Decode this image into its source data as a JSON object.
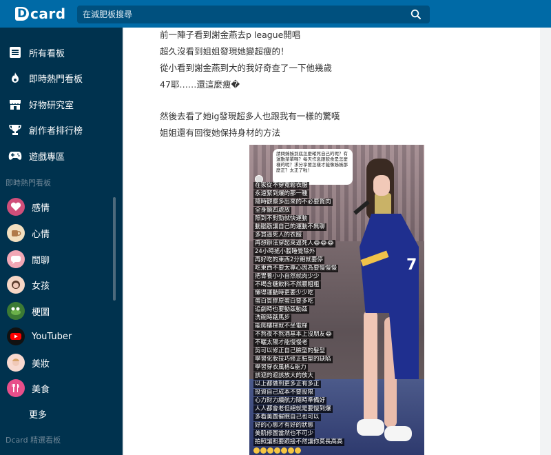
{
  "brand": {
    "name": "card",
    "letter": "D"
  },
  "search": {
    "placeholder": "在減肥板搜尋"
  },
  "sidebar": {
    "nav": [
      {
        "label": "所有看板",
        "icon": "list-icon"
      },
      {
        "label": "即時熱門看板",
        "icon": "fire-icon"
      },
      {
        "label": "好物研究室",
        "icon": "store-icon"
      },
      {
        "label": "創作者排行榜",
        "icon": "trophy-icon"
      },
      {
        "label": "遊戲專區",
        "icon": "gamepad-icon"
      }
    ],
    "hot_section_title": "即時熱門看板",
    "boards": [
      {
        "label": "感情",
        "color": "#d04f7a"
      },
      {
        "label": "心情",
        "color": "#f3e0c0"
      },
      {
        "label": "閒聊",
        "color": "#f2a7b5"
      },
      {
        "label": "女孩",
        "color": "#f6d7c6"
      },
      {
        "label": "梗圖",
        "color": "#3c7a34"
      },
      {
        "label": "YouTuber",
        "color": "#ff0000"
      },
      {
        "label": "美妝",
        "color": "#f8d9d0"
      },
      {
        "label": "美食",
        "color": "#e84f8a"
      }
    ],
    "more_label": "更多",
    "dcard_picks_title": "Dcard 精選看板"
  },
  "post": {
    "lines": [
      "前一陣子看到謝金燕去p league開唱",
      "超久沒看到姐姐發現她變超瘦的！",
      "從小看到謝金燕到大的我好奇查了一下他幾歲",
      "47耶……還這麼瘦�",
      "然後去看了她ig發現超多人也跟我有一樣的驚嘆",
      "姐姐還有回復她保持身材的方法"
    ],
    "image": {
      "question": "請問姊姊到底怎麼確死自己的呢？有運動菜單嗎？每天作息跟飲食是怎麼樣的呢？求分享要怎樣才能像姊姊那麼正？太正了啦！",
      "captions": [
        "在家從不穿寬鬆衣服",
        "永遠緊到爆的那一種",
        "隨時觀察多出來的不必要贅肉",
        "全身鏡四處放",
        "照到不對勁就快運動",
        "動腦筋讓自己的運動不無聊",
        "多買逼死人的衣服",
        "再想辦法穿起來逼死人😂😂😂",
        "24小時搖小腹睡覺除外",
        "再好吃的東西2分飽就要停",
        "吃東西不要太專心因為要慢慢慢",
        "把胃養小小自然就肉少少",
        "不喝含糖飲料不然腰粗粗",
        "懶得運動時更要少少吃",
        "蛋白質膠原蛋白要多吃",
        "追劇時也要動茲動茲",
        "洗碗時踮馬步",
        "能爬樓梯就不坐電梯",
        "不熬夜不熬酒基本上沒朋友😂",
        "不曬太陽才能慢慢老",
        "剪可以修正自己臉型的髮型",
        "學習化妝技巧修正臉型的缺陷",
        "學習穿衣風格&能力",
        "該遮的遮該放大的放大",
        "以上都做到更多正有多正",
        "投資自己成本不要設限",
        "心力財力續航力隨時準備好",
        "人人都會老但絕就是要慢到爆",
        "多看美圖催眠自己也可以",
        "好的心態才有好的狀態",
        "美肌修圖當然也不可少",
        "拍照讓照要跟接不然讓你莫長高高"
      ],
      "jersey_number": "7"
    }
  },
  "colors": {
    "topbar": "#006aa6",
    "sidebar": "#00324e"
  }
}
